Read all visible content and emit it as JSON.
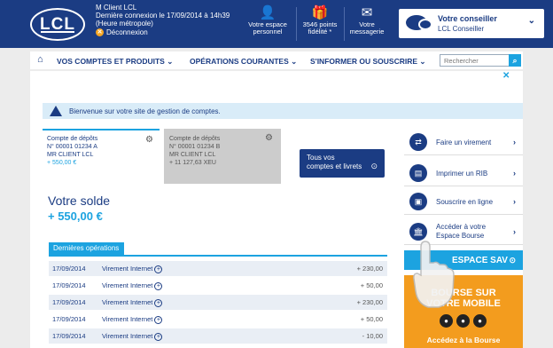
{
  "header": {
    "logo_text": "LCL",
    "user_name": "M Client LCL",
    "last_login": "Dernière connexion le 17/09/2014 à 14h39",
    "timezone": "(Heure métropole)",
    "logout": "Déconnexion",
    "nav": [
      {
        "label1": "Votre espace",
        "label2": "personnel",
        "icon": "user-icon"
      },
      {
        "label1": "3546 points",
        "label2": "fidélité *",
        "icon": "gift-icon"
      },
      {
        "label1": "Votre",
        "label2": "messagerie",
        "icon": "mail-icon"
      }
    ],
    "advisor": {
      "title": "Votre conseiller",
      "name": "LCL Conseiller"
    }
  },
  "navbar": {
    "items": [
      "VOS COMPTES ET PRODUITS",
      "OPÉRATIONS COURANTES",
      "S'INFORMER OU SOUSCRIRE"
    ],
    "search_placeholder": "Rechercher"
  },
  "welcome": "Bienvenue sur votre site de gestion de comptes.",
  "accounts": [
    {
      "type": "Compte de dépôts",
      "number": "N° 00001 01234 A",
      "holder": "MR CLIENT LCL",
      "balance": "+ 550,00 €"
    },
    {
      "type": "Compte de dépôts",
      "number": "N° 00001 01234 B",
      "holder": "MR CLIENT LCL",
      "balance": "+ 11 127,63 XEU"
    }
  ],
  "all_accounts": {
    "line1": "Tous vos",
    "line2": "comptes et livrets"
  },
  "solde": {
    "label": "Votre solde",
    "value": "+ 550,00 €"
  },
  "operations": {
    "tab": "Dernières opérations",
    "rows": [
      {
        "date": "17/09/2014",
        "label": "Virement Internet",
        "amount": "+ 230,00"
      },
      {
        "date": "17/09/2014",
        "label": "Virement Internet",
        "amount": "+ 50,00"
      },
      {
        "date": "17/09/2014",
        "label": "Virement Internet",
        "amount": "+ 230,00"
      },
      {
        "date": "17/09/2014",
        "label": "Virement Internet",
        "amount": "+ 50,00"
      },
      {
        "date": "17/09/2014",
        "label": "Virement Internet",
        "amount": "- 10,00"
      }
    ]
  },
  "quick_actions": [
    {
      "label": "Faire un virement",
      "icon": "transfer-icon"
    },
    {
      "label": "Imprimer un RIB",
      "icon": "document-icon"
    },
    {
      "label": "Souscrire en ligne",
      "icon": "subscribe-icon"
    },
    {
      "label1": "Accéder à votre",
      "label2": "Espace Bourse",
      "icon": "bank-icon"
    }
  ],
  "sav": "ESPACE SAV",
  "bourse_promo": {
    "line1": "BOURSE SUR",
    "line2": "VOTRE MOBILE",
    "cta": "Accédez à la Bourse"
  }
}
